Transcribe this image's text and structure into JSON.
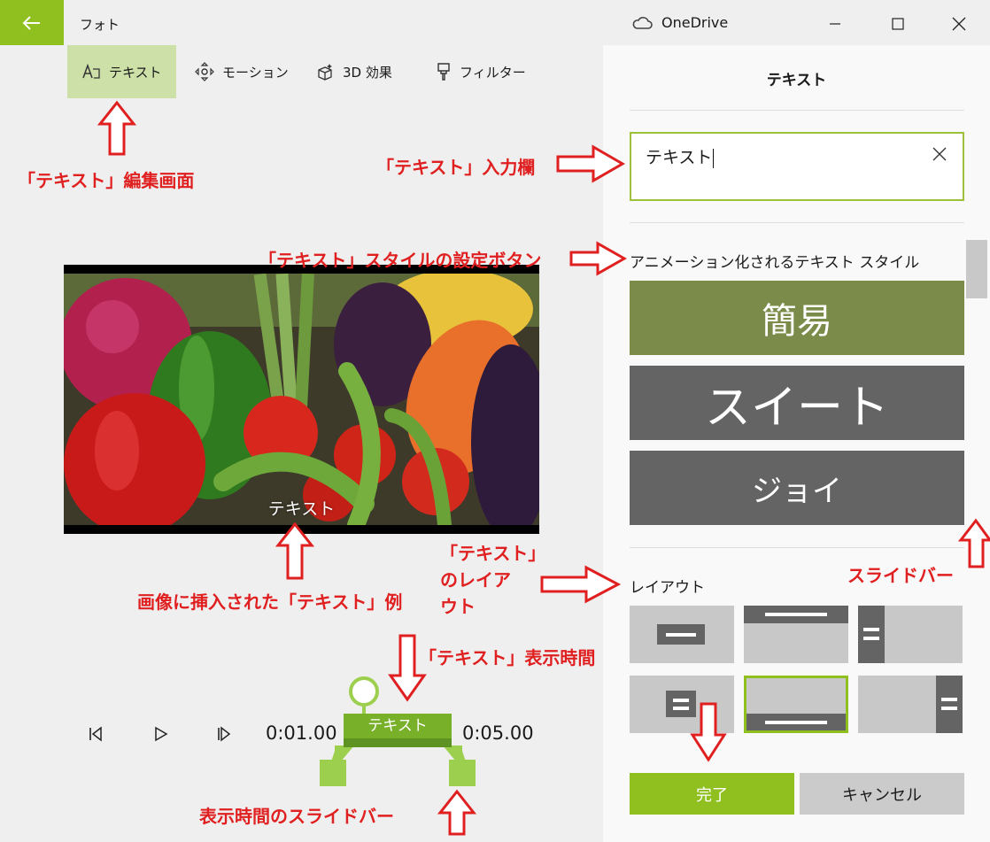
{
  "titlebar": {
    "app_name": "フォト",
    "onedrive_label": "OneDrive"
  },
  "toolbar": {
    "tabs": [
      {
        "label": "テキスト",
        "icon": "text-icon",
        "active": true
      },
      {
        "label": "モーション",
        "icon": "motion-icon",
        "active": false
      },
      {
        "label": "3D 効果",
        "icon": "3d-effects-icon",
        "active": false
      },
      {
        "label": "フィルター",
        "icon": "filter-icon",
        "active": false
      }
    ]
  },
  "preview": {
    "overlay_text": "テキスト"
  },
  "playback": {
    "start_time": "0:01.00",
    "end_time": "0:05.00",
    "timeline_label": "テキスト"
  },
  "panel": {
    "title": "テキスト",
    "input_value": "テキスト",
    "styles_heading": "アニメーション化されるテキスト スタイル",
    "styles": [
      {
        "label": "簡易",
        "color": "#7b8c4a"
      },
      {
        "label": "スイート",
        "color": "#646464"
      },
      {
        "label": "ジョイ",
        "color": "#646464"
      }
    ],
    "layout_heading": "レイアウト",
    "done_label": "完了",
    "cancel_label": "キャンセル"
  },
  "annotations": {
    "text_edit_screen": "「テキスト」編集画面",
    "text_input_field": "「テキスト」入力欄",
    "style_setting_buttons": "「テキスト」スタイルの設定ボタン",
    "inserted_text_example": "画像に挿入された「テキスト」例",
    "layout_line1": "「テキスト」",
    "layout_line2": "のレイア",
    "layout_line3": "ウト",
    "display_time": "「テキスト」表示時間",
    "display_time_slider": "表示時間のスライドバー",
    "scroll_bar": "スライドバー"
  },
  "colors": {
    "accent": "#8fc020",
    "annotation": "#e02020",
    "timeline": "#78b02a"
  }
}
